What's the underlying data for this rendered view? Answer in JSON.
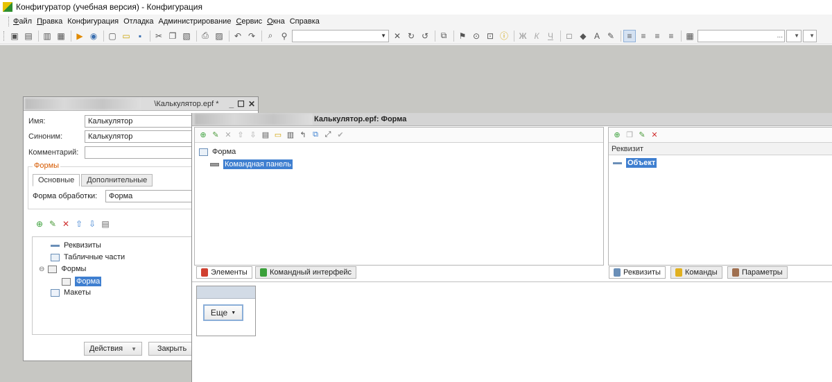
{
  "app": {
    "title": "Конфигуратор (учебная версия) - Конфигурация"
  },
  "menu": [
    {
      "label": "Файл",
      "first": "Ф",
      "rest": "айл"
    },
    {
      "label": "Правка",
      "first": "П",
      "rest": "равка"
    },
    {
      "label": "Конфигурация",
      "first": "",
      "rest": "Конфигурация"
    },
    {
      "label": "Отладка",
      "first": "",
      "rest": "Отладка"
    },
    {
      "label": "Администрирование",
      "first": "",
      "rest": "Администрирование"
    },
    {
      "label": "Сервис",
      "first": "С",
      "rest": "ервис"
    },
    {
      "label": "Окна",
      "first": "О",
      "rest": "кна"
    },
    {
      "label": "Справка",
      "first": "",
      "rest": "Справка"
    }
  ],
  "toolbar": {
    "search_value": "",
    "field_right_suffix": "..."
  },
  "object_window": {
    "title": "\\Калькулятор.epf *",
    "name_label": "Имя:",
    "name_value": "Калькулятор",
    "synonym_label": "Синоним:",
    "synonym_value": "Калькулятор",
    "comment_label": "Комментарий:",
    "comment_value": "",
    "forms_group_label": "Формы",
    "tabs": [
      "Основные",
      "Дополнительные"
    ],
    "processing_form_label": "Форма обработки:",
    "processing_form_value": "Форма",
    "tree": {
      "requisites": "Реквизиты",
      "tabular_parts": "Табличные части",
      "forms": "Формы",
      "form": "Форма",
      "layouts": "Макеты",
      "forms_toggle": "⊖"
    },
    "actions_button": "Действия",
    "close_button": "Закрыть"
  },
  "form_window": {
    "title": "Калькулятор.epf: Форма",
    "elements_tree": {
      "root": "Форма",
      "command_panel": "Командная панель"
    },
    "requisites_header": "Реквизит",
    "requisites_selected": "Объект",
    "left_tabs": [
      "Элементы",
      "Командный интерфейс"
    ],
    "right_tabs": [
      "Реквизиты",
      "Команды",
      "Параметры"
    ],
    "preview_button": "Еще"
  },
  "colors": {
    "selection": "#3f7fd0",
    "workspace": "#c7c7c3",
    "legend": "#d65a00"
  }
}
